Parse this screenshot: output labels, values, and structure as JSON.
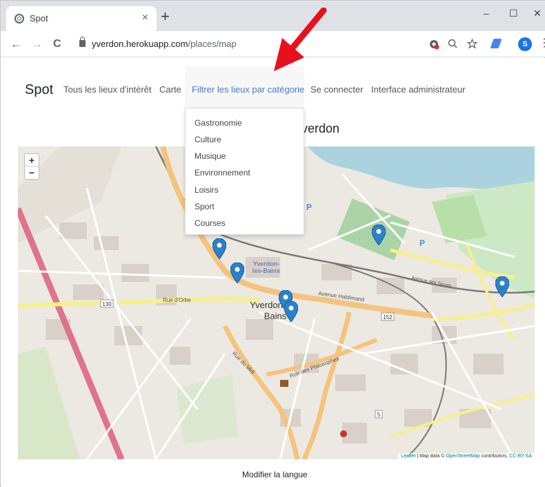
{
  "browser": {
    "tab_title": "Spot",
    "tab_close": "×",
    "new_tab": "+",
    "minimize": "–",
    "maximize": "☐",
    "close": "✕",
    "back": "←",
    "forward": "→",
    "reload": "C",
    "url_domain": "yverdon.herokuapp.com",
    "url_path": "/places/map",
    "profile_initial": "S",
    "kebab": "⋮"
  },
  "navbar": {
    "brand": "Spot",
    "links": [
      "Tous les lieux d'intérêt",
      "Carte",
      "Filtrer les lieux par catégorie",
      "Se connecter",
      "Interface administrateur"
    ]
  },
  "dropdown": {
    "items": [
      "Gastronomie",
      "Culture",
      "Musique",
      "Environnement",
      "Loisirs",
      "Sport",
      "Courses"
    ]
  },
  "page": {
    "heading": "/verdon"
  },
  "map": {
    "zoom_in": "+",
    "zoom_out": "−",
    "labels": {
      "yverdon_station": "Yverdon-les-Bains",
      "city_line1": "Yverdon",
      "city_line2": "Bains",
      "rue_orbe": "Rue d'Orbe",
      "avenue_haldimand": "Avenue Haldimand",
      "avenue_sports": "Avenue des Sports",
      "rue_midi": "Rue du Midi",
      "rue_philosophes": "Rue des Philosophes",
      "route_130": "130",
      "route_152": "152",
      "route_5": "5"
    },
    "attribution_leaflet": "Leaflet",
    "attribution_text1": " | Map data © ",
    "attribution_osm": "OpenStreetMap",
    "attribution_text2": " contributors, ",
    "attribution_license": "CC-BY-SA"
  },
  "footer": {
    "language_link": "Modifier la langue"
  },
  "colors": {
    "accent_link": "#4a79c8",
    "marker": "#2a81cb",
    "lake": "#aad3df",
    "annotation_arrow": "#e8101a"
  }
}
